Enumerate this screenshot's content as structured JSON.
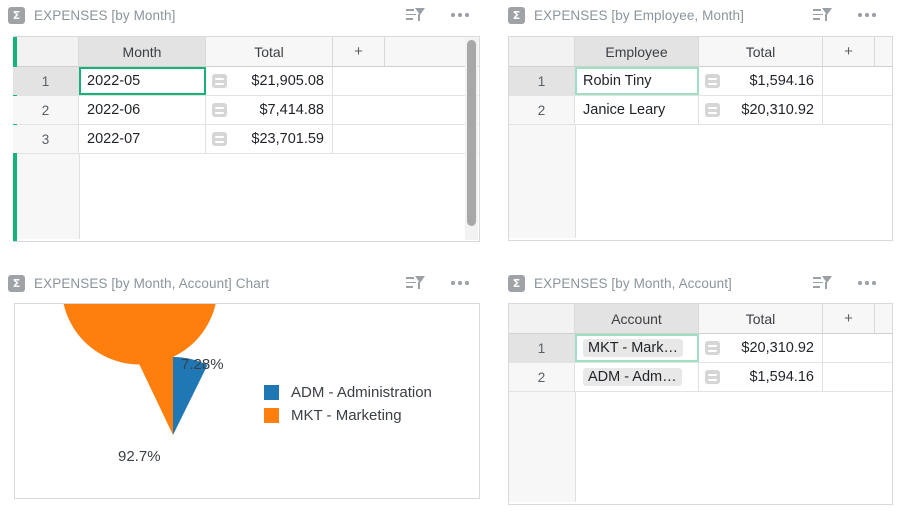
{
  "theme": {
    "accent_green": "#16b378",
    "series_blue": "#1f77b4",
    "series_orange": "#ff7f0e",
    "title_gray": "#8a949c"
  },
  "widgets": [
    {
      "id": "expenses-by-month",
      "title": "EXPENSES [by Month]",
      "icon": "sigma-icon",
      "sort_filter_icon": "sort-filter-icon",
      "menu_icon": "options-dots-icon",
      "selected": true,
      "columns": [
        "Month",
        "Total"
      ],
      "add_column_label": "+",
      "rows": [
        {
          "num": "1",
          "month": "2022-05",
          "total": "$21,905.08"
        },
        {
          "num": "2",
          "month": "2022-06",
          "total": "$7,414.88"
        },
        {
          "num": "3",
          "month": "2022-07",
          "total": "$23,701.59"
        }
      ],
      "has_scrollbar": true
    },
    {
      "id": "expenses-by-employee-month",
      "title": "EXPENSES [by Employee, Month]",
      "icon": "sigma-icon",
      "sort_filter_icon": "sort-filter-icon",
      "menu_icon": "options-dots-icon",
      "selected": false,
      "columns": [
        "Employee",
        "Total"
      ],
      "add_column_label": "+",
      "rows": [
        {
          "num": "1",
          "employee": "Robin Tiny",
          "total": "$1,594.16"
        },
        {
          "num": "2",
          "employee": "Janice Leary",
          "total": "$20,310.92"
        }
      ],
      "has_scrollbar": false
    },
    {
      "id": "expenses-by-month-account-chart",
      "title": "EXPENSES [by Month, Account] Chart",
      "icon": "sigma-icon",
      "sort_filter_icon": "sort-filter-icon",
      "menu_icon": "options-dots-icon",
      "selected": false
    },
    {
      "id": "expenses-by-month-account",
      "title": "EXPENSES [by Month, Account]",
      "icon": "sigma-icon",
      "sort_filter_icon": "sort-filter-icon",
      "menu_icon": "options-dots-icon",
      "selected": false,
      "columns": [
        "Account",
        "Total"
      ],
      "add_column_label": "+",
      "rows": [
        {
          "num": "1",
          "account": "MKT - Mark…",
          "total": "$20,310.92"
        },
        {
          "num": "2",
          "account": "ADM - Adm…",
          "total": "$1,594.16"
        }
      ],
      "has_scrollbar": false
    }
  ],
  "chart_data": {
    "type": "pie",
    "title": "EXPENSES [by Month, Account] Chart",
    "categories": [
      "ADM - Administration",
      "MKT - Marketing"
    ],
    "values": [
      7.28,
      92.7
    ],
    "data_labels": [
      "7.28%",
      "92.7%"
    ],
    "colors": [
      "#1f77b4",
      "#ff7f0e"
    ],
    "legend": {
      "position": "right",
      "entries": [
        {
          "label": "ADM - Administration",
          "color": "#1f77b4"
        },
        {
          "label": "MKT - Marketing",
          "color": "#ff7f0e"
        }
      ]
    },
    "start_angle_deg": 0,
    "direction": "clockwise",
    "grid": false
  }
}
